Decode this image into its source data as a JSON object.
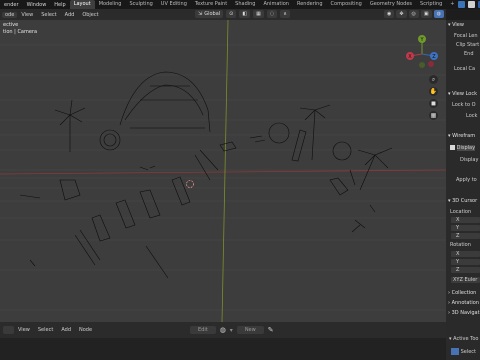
{
  "topbar": {
    "menus": [
      "ender",
      "Window",
      "Help"
    ],
    "workspaces": [
      "Layout",
      "Modeling",
      "Sculpting",
      "UV Editing",
      "Texture Paint",
      "Shading",
      "Animation",
      "Rendering",
      "Compositing",
      "Geometry Nodes",
      "Scripting"
    ],
    "active_workspace": "Layout",
    "add_tab": "+"
  },
  "viewport_header": {
    "mode": "ode",
    "menus": [
      "View",
      "Select",
      "Add",
      "Object"
    ],
    "orientation": "Global"
  },
  "viewport": {
    "info_line1": "ective",
    "info_line2": "tion | Camera",
    "gizmo": {
      "x": "X",
      "y": "Y",
      "z": "Z"
    },
    "colors": {
      "grid": "#4a4a4a",
      "x_axis": "#8a3a3a",
      "y_axis": "#7c8f2a",
      "wire": "#0d0d0d",
      "bg": "#3d3d3d"
    }
  },
  "n_panel": {
    "view_header": "View",
    "focal_length": "Focal Len",
    "clip_start": "Clip Start",
    "clip_end": "End",
    "local_camera": "Local Ca",
    "view_lock": "View Lock",
    "lock_to_object": "Lock to O",
    "lock": "Lock",
    "wireframe": "Wirefram",
    "display": "Display",
    "display2": "Display",
    "apply_to": "Apply to",
    "cursor_header": "3D Cursor",
    "location": "Location",
    "loc_x": "X",
    "loc_y": "Y",
    "loc_z": "Z",
    "rotation": "Rotation",
    "rot_x": "X",
    "rot_y": "Y",
    "rot_z": "Z",
    "euler": "XYZ Euler",
    "collections": "Collection",
    "annotations": "Annotation",
    "navigation": "3D Navigat",
    "active_tool": "Active Too",
    "select": "Select"
  },
  "bottom_header": {
    "menus": [
      "View",
      "Select",
      "Add",
      "Node"
    ],
    "edit_label": "Edit",
    "new_label": "New"
  }
}
